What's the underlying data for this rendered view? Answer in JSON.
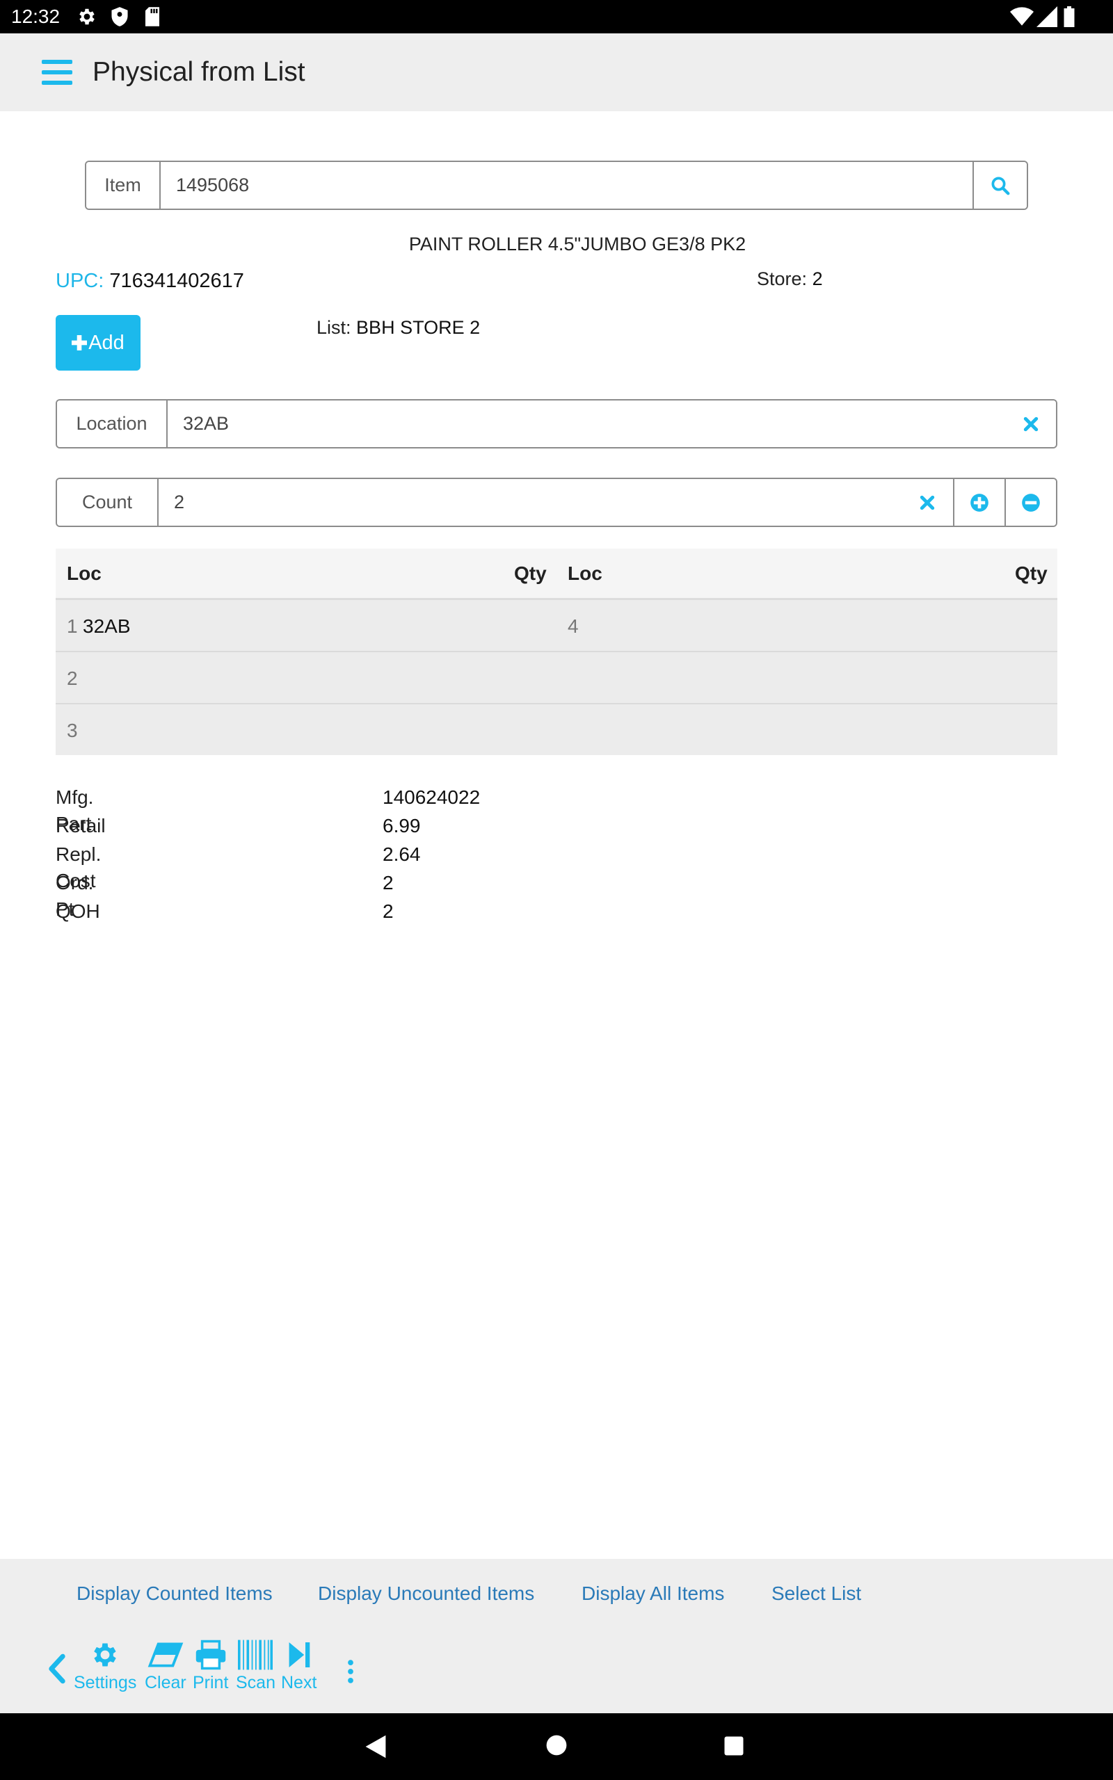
{
  "status_bar": {
    "time": "12:32"
  },
  "app_bar": {
    "title": "Physical from List"
  },
  "item_search": {
    "label": "Item",
    "value": "1495068"
  },
  "product": {
    "name": "PAINT ROLLER 4.5\"JUMBO GE3/8 PK2",
    "upc_label": "UPC:",
    "upc_value": "716341402617",
    "store_label": "Store:",
    "store_value": "2",
    "list_label": "List:",
    "list_value": "BBH STORE 2"
  },
  "add_button": {
    "label": "Add"
  },
  "location_field": {
    "label": "Location",
    "value": "32AB"
  },
  "count_field": {
    "label": "Count",
    "value": "2"
  },
  "loc_table": {
    "headers": [
      "Loc",
      "Qty",
      "Loc",
      "Qty"
    ],
    "rows": [
      {
        "num": "1",
        "loc": "32AB",
        "qty": "4"
      },
      {
        "num": "2",
        "loc": "",
        "qty": ""
      },
      {
        "num": "3",
        "loc": "",
        "qty": ""
      }
    ]
  },
  "details": [
    {
      "label": "Mfg. Part",
      "value": "140624022"
    },
    {
      "label": "Retail",
      "value": "6.99"
    },
    {
      "label": "Repl. Cost",
      "value": "2.64"
    },
    {
      "label": "Ord. Pt",
      "value": "2"
    },
    {
      "label": "QOH",
      "value": "2"
    }
  ],
  "bottom_links": [
    "Display Counted Items",
    "Display Uncounted Items",
    "Display All Items",
    "Select List"
  ],
  "toolbar": [
    "Settings",
    "Clear",
    "Print",
    "Scan",
    "Next"
  ],
  "colors": {
    "accent": "#1cb9ec",
    "link": "#2a7ab8",
    "app_bar": "#eeeeee"
  }
}
